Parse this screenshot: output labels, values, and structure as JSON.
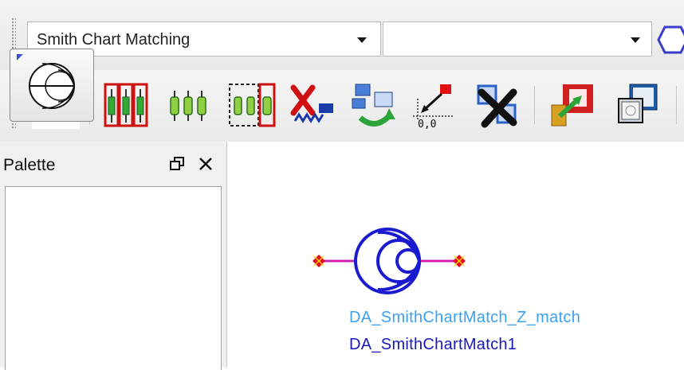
{
  "toolbar_top": {
    "component_combo": {
      "value": "Smith Chart Matching"
    },
    "second_combo": {
      "value": ""
    }
  },
  "toolbar_icons": [
    {
      "name": "blank-icon"
    },
    {
      "name": "insert-components-icon"
    },
    {
      "name": "components-icon"
    },
    {
      "name": "select-components-icon"
    },
    {
      "name": "delete-components-icon"
    },
    {
      "name": "hierarchy-sync-icon"
    },
    {
      "name": "move-to-origin-icon"
    },
    {
      "name": "deselect-all-icon"
    },
    {
      "name": "push-into-icon"
    },
    {
      "name": "window-icon"
    }
  ],
  "palette": {
    "title": "Palette",
    "restore_icon": "restore-icon",
    "close_icon": "close-icon",
    "items": [
      {
        "icon": "smith-chart-icon"
      }
    ]
  },
  "canvas": {
    "component": {
      "icon": "smith-chart-icon",
      "label_type": "DA_SmithChartMatch_Z_match",
      "label_instance": "DA_SmithChartMatch1",
      "colors": {
        "body": "#1a1ad0",
        "wire": "#d020b0",
        "pin": "#e01020",
        "type_label": "#3aa0f0",
        "instance_label": "#1818b8"
      }
    }
  }
}
